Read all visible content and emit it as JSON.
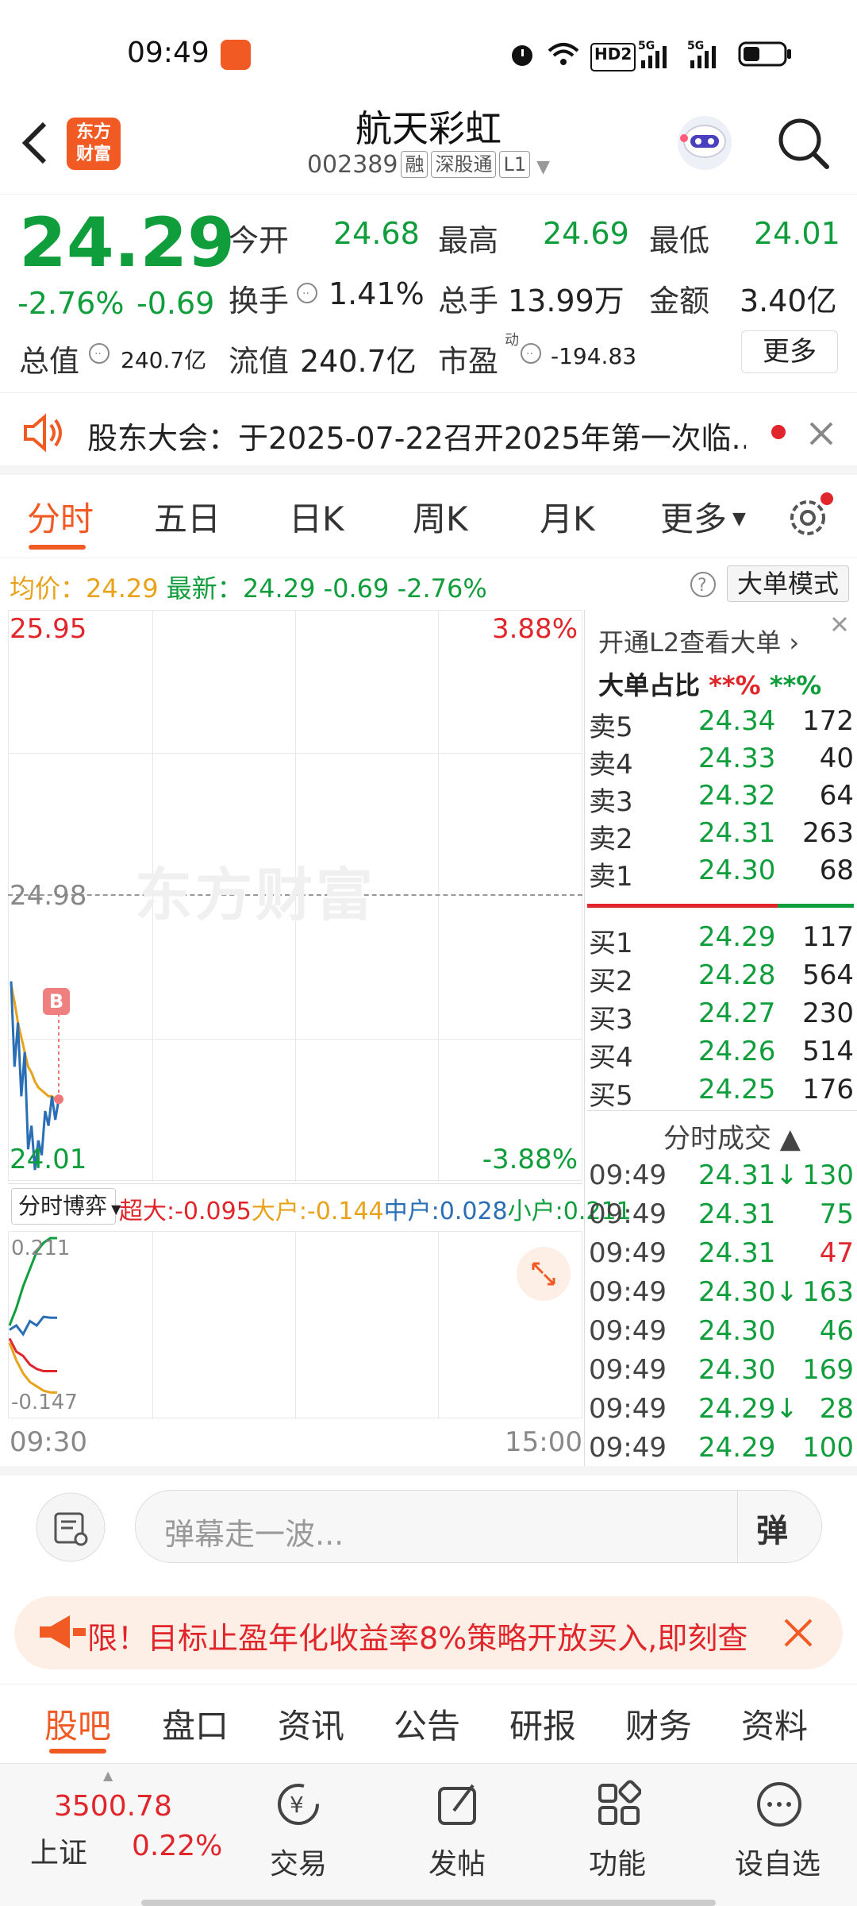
{
  "status_bar": {
    "time": "09:49",
    "network": "5G",
    "hd": "HD2"
  },
  "header": {
    "title": "航天彩虹",
    "code": "002389",
    "tag1": "融",
    "tag2": "深股通",
    "tag3": "L1",
    "logo_line1": "东方",
    "logo_line2": "财富"
  },
  "quote": {
    "price": "24.29",
    "change_pct": "-2.76%",
    "change": "-0.69",
    "open_label": "今开",
    "open": "24.68",
    "high_label": "最高",
    "high": "24.69",
    "low_label": "最低",
    "low": "24.01",
    "turnover_label": "换手",
    "turnover": "1.41%",
    "volume_label": "总手",
    "volume": "13.99万",
    "amount_label": "金额",
    "amount": "3.40亿",
    "mcap_label": "总值",
    "mcap": "240.7亿",
    "float_label": "流值",
    "float_mcap": "240.7亿",
    "pe_label": "市盈",
    "pe_sup": "动",
    "pe": "-194.83",
    "more": "更多"
  },
  "notice": {
    "text": "股东大会：于2025-07-22召开2025年第一次临..."
  },
  "chart_tabs": [
    "分时",
    "五日",
    "日K",
    "周K",
    "月K",
    "更多"
  ],
  "chart_info": {
    "avg_label": "均价：",
    "avg": "24.29",
    "latest_label": "最新：",
    "latest": "24.29",
    "chg": "-0.69",
    "pct": "-2.76%",
    "mode_button": "大单模式"
  },
  "chart_data": {
    "type": "line",
    "y_top_label": "25.95",
    "y_mid_label": "24.98",
    "y_bottom_label": "24.01",
    "pct_top_label": "3.88%",
    "pct_bottom_label": "-3.88%",
    "x_start": "09:30",
    "x_end": "15:00",
    "ylim": [
      24.01,
      25.95
    ],
    "price": [
      24.69,
      24.4,
      24.55,
      24.3,
      24.45,
      24.12,
      24.2,
      24.05,
      24.15,
      24.1,
      24.25,
      24.2,
      24.3,
      24.22,
      24.29
    ],
    "avg": [
      24.68,
      24.62,
      24.55,
      24.5,
      24.45,
      24.4,
      24.38,
      24.35,
      24.33,
      24.32,
      24.31,
      24.3,
      24.3,
      24.29,
      24.29
    ],
    "marker": "B",
    "watermark": "东方财富"
  },
  "flow": {
    "selector": "分时博弈",
    "super": "超大:-0.095",
    "big": "大户:-0.144",
    "mid": "中户:0.028",
    "small": "小户:0.211",
    "top": "0.211",
    "bottom": "-0.147",
    "chart_data": {
      "type": "line",
      "ylim": [
        -0.147,
        0.211
      ],
      "series": [
        {
          "name": "超大",
          "values": [
            -0.02,
            -0.05,
            -0.06,
            -0.08,
            -0.09,
            -0.095,
            -0.095,
            -0.095
          ]
        },
        {
          "name": "大户",
          "values": [
            -0.03,
            -0.07,
            -0.1,
            -0.12,
            -0.13,
            -0.14,
            -0.144,
            -0.144
          ]
        },
        {
          "name": "中户",
          "values": [
            0.0,
            0.01,
            -0.01,
            0.02,
            0.01,
            0.03,
            0.028,
            0.028
          ]
        },
        {
          "name": "小户",
          "values": [
            0.01,
            0.05,
            0.1,
            0.14,
            0.18,
            0.2,
            0.211,
            0.211
          ]
        }
      ]
    }
  },
  "orderbook": {
    "l2_link": "开通L2查看大单",
    "ratio_label": "大单占比",
    "ratio_a": "**%",
    "ratio_b": "**%",
    "asks": [
      {
        "label": "卖5",
        "price": "24.34",
        "vol": "172"
      },
      {
        "label": "卖4",
        "price": "24.33",
        "vol": "40"
      },
      {
        "label": "卖3",
        "price": "24.32",
        "vol": "64"
      },
      {
        "label": "卖2",
        "price": "24.31",
        "vol": "263"
      },
      {
        "label": "卖1",
        "price": "24.30",
        "vol": "68"
      }
    ],
    "bids": [
      {
        "label": "买1",
        "price": "24.29",
        "vol": "117"
      },
      {
        "label": "买2",
        "price": "24.28",
        "vol": "564"
      },
      {
        "label": "买3",
        "price": "24.27",
        "vol": "230"
      },
      {
        "label": "买4",
        "price": "24.26",
        "vol": "514"
      },
      {
        "label": "买5",
        "price": "24.25",
        "vol": "176"
      }
    ],
    "trades_title": "分时成交",
    "trades": [
      {
        "time": "09:49",
        "price": "24.31",
        "arrow": "↓",
        "vol": "130",
        "vol_color": "#109e3c"
      },
      {
        "time": "09:49",
        "price": "24.31",
        "arrow": "",
        "vol": "75",
        "vol_color": "#109e3c"
      },
      {
        "time": "09:49",
        "price": "24.31",
        "arrow": "",
        "vol": "47",
        "vol_color": "#e0262b"
      },
      {
        "time": "09:49",
        "price": "24.30",
        "arrow": "↓",
        "vol": "163",
        "vol_color": "#109e3c"
      },
      {
        "time": "09:49",
        "price": "24.30",
        "arrow": "",
        "vol": "46",
        "vol_color": "#109e3c"
      },
      {
        "time": "09:49",
        "price": "24.30",
        "arrow": "",
        "vol": "169",
        "vol_color": "#109e3c"
      },
      {
        "time": "09:49",
        "price": "24.29",
        "arrow": "↓",
        "vol": "28",
        "vol_color": "#109e3c"
      },
      {
        "time": "09:49",
        "price": "24.29",
        "arrow": "",
        "vol": "100",
        "vol_color": "#109e3c"
      }
    ]
  },
  "danmu": {
    "placeholder": "弹幕走一波...",
    "button": "弹"
  },
  "promo": {
    "text": "限！目标止盈年化收益率8%策略开放买入,即刻查"
  },
  "bottom_tabs": [
    "股吧",
    "盘口",
    "资讯",
    "公告",
    "研报",
    "财务",
    "资料"
  ],
  "nav": {
    "index_value": "3500.78",
    "index_name": "上证",
    "index_pct": "0.22%",
    "items": [
      "交易",
      "发帖",
      "功能",
      "设自选"
    ]
  }
}
